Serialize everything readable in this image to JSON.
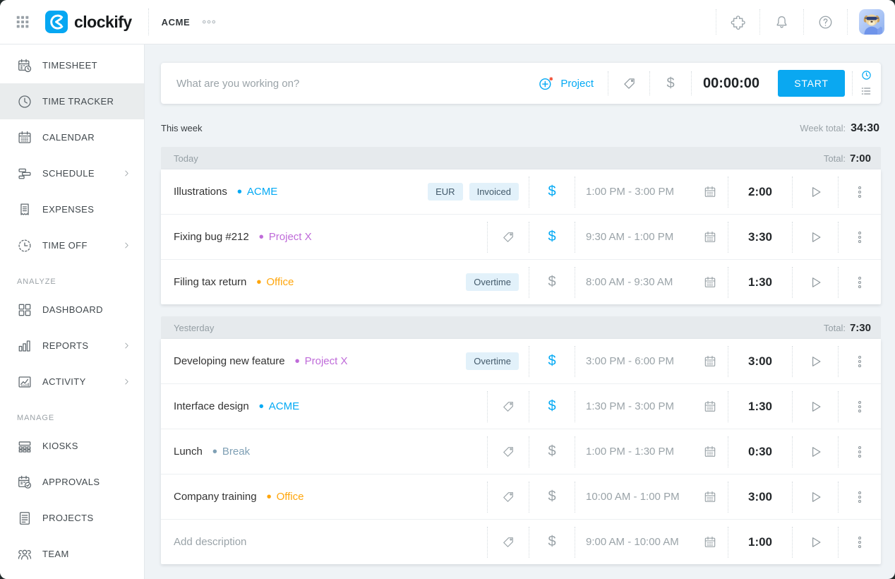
{
  "colors": {
    "accent": "#03a9f4",
    "billable": "#03a9f4",
    "non_billable": "#9aa3a8",
    "badge_bg": "#e2f1fa",
    "project_acme": "#03a9f4",
    "project_x": "#bf6bd9",
    "project_office": "#ffa60c",
    "project_break": "#7fa0b5"
  },
  "topbar": {
    "logo_text": "clockify",
    "workspace": "ACME",
    "right_icons": [
      {
        "name": "integrations",
        "icon": "puzzle"
      },
      {
        "name": "notifications",
        "icon": "bell"
      },
      {
        "name": "help",
        "icon": "help"
      }
    ]
  },
  "sidebar": {
    "sections": [
      {
        "label": null,
        "items": [
          {
            "label": "TIMESHEET",
            "icon": "timesheet",
            "chevron": false,
            "active": false
          },
          {
            "label": "TIME TRACKER",
            "icon": "clock",
            "chevron": false,
            "active": true
          },
          {
            "label": "CALENDAR",
            "icon": "calendar",
            "chevron": false,
            "active": false
          },
          {
            "label": "SCHEDULE",
            "icon": "schedule",
            "chevron": true,
            "active": false
          },
          {
            "label": "EXPENSES",
            "icon": "expenses",
            "chevron": false,
            "active": false
          },
          {
            "label": "TIME OFF",
            "icon": "timeoff",
            "chevron": true,
            "active": false
          }
        ]
      },
      {
        "label": "ANALYZE",
        "items": [
          {
            "label": "DASHBOARD",
            "icon": "dashboard",
            "chevron": false,
            "active": false
          },
          {
            "label": "REPORTS",
            "icon": "reports",
            "chevron": true,
            "active": false
          },
          {
            "label": "ACTIVITY",
            "icon": "activity",
            "chevron": true,
            "active": false
          }
        ]
      },
      {
        "label": "MANAGE",
        "items": [
          {
            "label": "KIOSKS",
            "icon": "kiosks",
            "chevron": false,
            "active": false
          },
          {
            "label": "APPROVALS",
            "icon": "approvals",
            "chevron": false,
            "active": false
          },
          {
            "label": "PROJECTS",
            "icon": "projects",
            "chevron": false,
            "active": false
          },
          {
            "label": "TEAM",
            "icon": "team",
            "chevron": false,
            "active": false
          }
        ]
      }
    ]
  },
  "tracker": {
    "placeholder": "What are you working on?",
    "project_label": "Project",
    "billable_symbol": "$",
    "timer_value": "00:00:00",
    "start_label": "START"
  },
  "week": {
    "label": "This week",
    "total_label": "Week total:",
    "total": "34:30"
  },
  "groups": [
    {
      "label": "Today",
      "total_label": "Total:",
      "total": "7:00",
      "entries": [
        {
          "description": "Illustrations",
          "project": {
            "name": "ACME",
            "color": "#03a9f4"
          },
          "badges": [
            "EUR",
            "Invoiced"
          ],
          "billable": true,
          "time_range": "1:00 PM - 3:00 PM",
          "duration": "2:00"
        },
        {
          "description": "Fixing bug #212",
          "project": {
            "name": "Project X",
            "color": "#bf6bd9"
          },
          "badges": [],
          "billable": true,
          "time_range": "9:30 AM - 1:00 PM",
          "duration": "3:30"
        },
        {
          "description": "Filing tax return",
          "project": {
            "name": "Office",
            "color": "#ffa60c"
          },
          "badges": [
            "Overtime"
          ],
          "billable": false,
          "time_range": "8:00 AM - 9:30 AM",
          "duration": "1:30"
        }
      ]
    },
    {
      "label": "Yesterday",
      "total_label": "Total:",
      "total": "7:30",
      "entries": [
        {
          "description": "Developing new feature",
          "project": {
            "name": "Project X",
            "color": "#bf6bd9"
          },
          "badges": [
            "Overtime"
          ],
          "billable": true,
          "time_range": "3:00 PM - 6:00 PM",
          "duration": "3:00"
        },
        {
          "description": "Interface design",
          "project": {
            "name": "ACME",
            "color": "#03a9f4"
          },
          "badges": [],
          "billable": true,
          "time_range": "1:30 PM - 3:00 PM",
          "duration": "1:30"
        },
        {
          "description": "Lunch",
          "project": {
            "name": "Break",
            "color": "#7fa0b5"
          },
          "badges": [],
          "billable": false,
          "time_range": "1:00 PM - 1:30 PM",
          "duration": "0:30"
        },
        {
          "description": "Company training",
          "project": {
            "name": "Office",
            "color": "#ffa60c"
          },
          "badges": [],
          "billable": false,
          "time_range": "10:00 AM - 1:00 PM",
          "duration": "3:00"
        },
        {
          "description": "",
          "placeholder": "Add description",
          "project": null,
          "badges": [],
          "billable": false,
          "time_range": "9:00 AM - 10:00 AM",
          "duration": "1:00"
        }
      ]
    }
  ]
}
